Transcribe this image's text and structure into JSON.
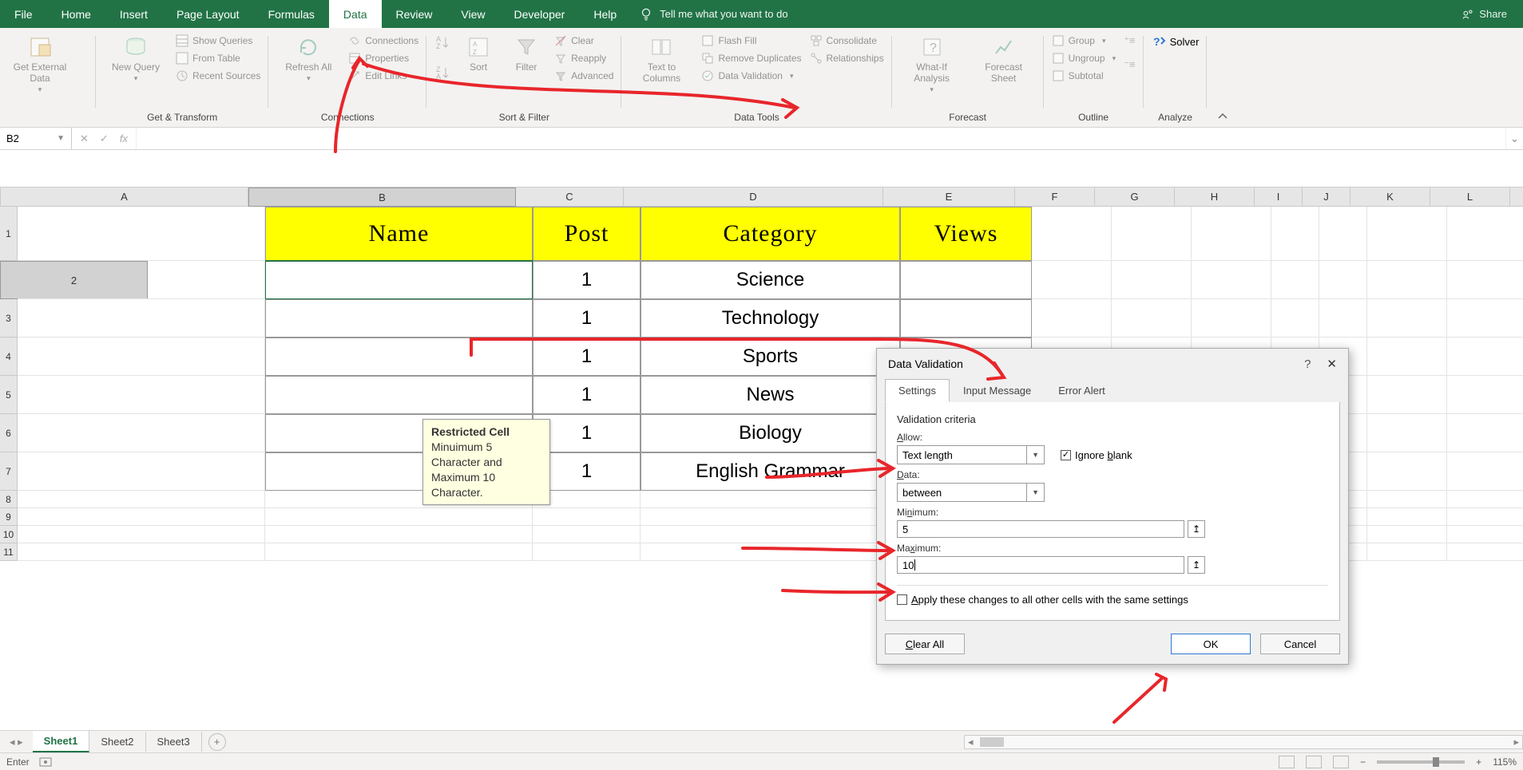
{
  "menu": {
    "tabs": [
      "File",
      "Home",
      "Insert",
      "Page Layout",
      "Formulas",
      "Data",
      "Review",
      "View",
      "Developer",
      "Help"
    ],
    "active_index": 5,
    "tell_me": "Tell me what you want to do",
    "share": "Share"
  },
  "ribbon": {
    "groups": {
      "get_transform": {
        "label": "Get & Transform",
        "get_external": "Get External Data",
        "new_query": "New Query",
        "show_queries": "Show Queries",
        "from_table": "From Table",
        "recent_sources": "Recent Sources"
      },
      "connections": {
        "label": "Connections",
        "refresh_all": "Refresh All",
        "connections": "Connections",
        "properties": "Properties",
        "edit_links": "Edit Links"
      },
      "sort_filter": {
        "label": "Sort & Filter",
        "sort": "Sort",
        "filter": "Filter",
        "clear": "Clear",
        "reapply": "Reapply",
        "advanced": "Advanced"
      },
      "data_tools": {
        "label": "Data Tools",
        "text_to_columns": "Text to Columns",
        "flash_fill": "Flash Fill",
        "remove_duplicates": "Remove Duplicates",
        "data_validation": "Data Validation",
        "consolidate": "Consolidate",
        "relationships": "Relationships"
      },
      "forecast": {
        "label": "Forecast",
        "what_if": "What-If Analysis",
        "forecast_sheet": "Forecast Sheet"
      },
      "outline": {
        "label": "Outline",
        "group": "Group",
        "ungroup": "Ungroup",
        "subtotal": "Subtotal"
      },
      "analyze": {
        "label": "Analyze",
        "solver": "Solver"
      }
    }
  },
  "namebox": {
    "value": "B2"
  },
  "columns": {
    "A": 310,
    "B": 335,
    "C": 135,
    "D": 325,
    "E": 165,
    "F": 100,
    "G": 100,
    "H": 100,
    "I": 60,
    "J": 60,
    "K": 100,
    "L": 100,
    "M": 100
  },
  "headers": {
    "B": "Name",
    "C": "Post",
    "D": "Category",
    "E": "Views"
  },
  "table_rows": [
    {
      "C": "1",
      "D": "Science"
    },
    {
      "C": "1",
      "D": "Technology"
    },
    {
      "C": "1",
      "D": "Sports"
    },
    {
      "C": "1",
      "D": "News"
    },
    {
      "C": "1",
      "D": "Biology"
    },
    {
      "C": "1",
      "D": "English Grammar"
    }
  ],
  "tooltip": {
    "title": "Restricted Cell",
    "body": "Minuimum 5 Character and Maximum 10 Character."
  },
  "dialog": {
    "title": "Data Validation",
    "tabs": [
      "Settings",
      "Input Message",
      "Error Alert"
    ],
    "active_tab": 0,
    "criteria_label": "Validation criteria",
    "allow_label": "Allow:",
    "allow_value": "Text length",
    "ignore_blank": "Ignore blank",
    "ignore_blank_checked": true,
    "data_label": "Data:",
    "data_value": "between",
    "min_label": "Minimum:",
    "min_value": "5",
    "max_label": "Maximum:",
    "max_value": "10",
    "apply_all": "Apply these changes to all other cells with the same settings",
    "apply_all_checked": false,
    "clear_all": "Clear All",
    "ok": "OK",
    "cancel": "Cancel"
  },
  "sheets": {
    "tabs": [
      "Sheet1",
      "Sheet2",
      "Sheet3"
    ],
    "active_index": 0
  },
  "status": {
    "mode": "Enter",
    "zoom": "115%"
  }
}
